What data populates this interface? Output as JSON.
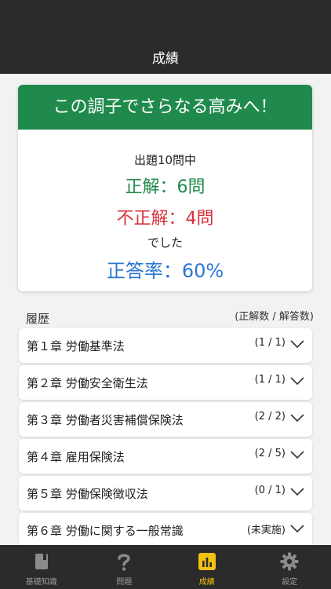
{
  "header": {
    "title": "成績"
  },
  "result": {
    "banner": "この調子でさらなる高みへ！",
    "total_line": "出題10問中",
    "correct_line": "正解：6問",
    "wrong_line": "不正解：4問",
    "deshita": "でした",
    "rate_line": "正答率：60%"
  },
  "history": {
    "label": "履歴",
    "legend": "(正解数 / 解答数)",
    "rows": [
      {
        "title": "第１章 労働基準法",
        "count": "(1 / 1)"
      },
      {
        "title": "第２章 労働安全衛生法",
        "count": "(1 / 1)"
      },
      {
        "title": "第３章 労働者災害補償保険法",
        "count": "(2 / 2)"
      },
      {
        "title": "第４章 雇用保険法",
        "count": "(2 / 5)"
      },
      {
        "title": "第５章 労働保険徴収法",
        "count": "(0 / 1)"
      },
      {
        "title": "第６章 労働に関する一般常識",
        "count": "(未実施)"
      }
    ]
  },
  "tabs": [
    {
      "label": "基礎知識",
      "icon": "book-icon",
      "active": false
    },
    {
      "label": "問題",
      "icon": "question-icon",
      "active": false
    },
    {
      "label": "成績",
      "icon": "bar-chart-icon",
      "active": true
    },
    {
      "label": "設定",
      "icon": "gear-icon",
      "active": false
    }
  ],
  "colors": {
    "accent_green": "#1f8a4c",
    "wrong_red": "#d7303d",
    "rate_blue": "#2b76d2",
    "active_tab": "#f3c20f"
  }
}
